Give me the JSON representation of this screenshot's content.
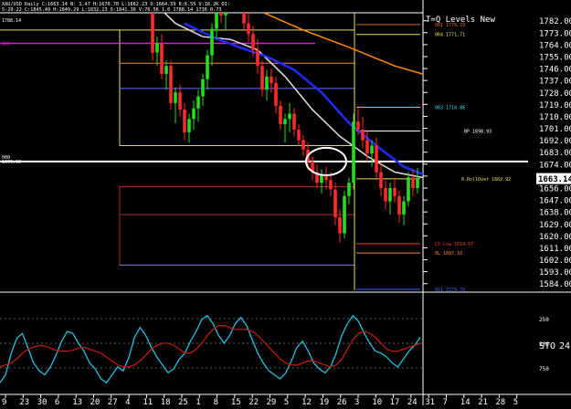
{
  "header": {
    "line1": "XAU/USD Daily C:1663.14  N:  1.47 H:1670.70 L:1662.23 O:1664.59 R:6.55 V:16.2K OI:",
    "line2": "5-20-22 C:1845.49 H:1849.29 L:1832.23 O:1841.36 V:76.5K 1.0 1788.14 1736 0.73",
    "left_value": "1788.14",
    "plot_title": "T=Q Levels New"
  },
  "chart_data": [
    {
      "type": "candlestick",
      "title": "XAU/USD Daily",
      "price_axis": {
        "ylim": [
          1579,
          1788
        ],
        "ticks": [
          1782,
          1773,
          1764,
          1755,
          1746,
          1737,
          1728,
          1719,
          1710,
          1701,
          1692,
          1683,
          1674,
          1665,
          1656,
          1647,
          1638,
          1629,
          1620,
          1611,
          1602,
          1593,
          1584
        ],
        "tick_labels": [
          "1782.00",
          "1773.00",
          "1764.00",
          "1755.00",
          "1746.00",
          "1737.00",
          "1728.00",
          "1719.00",
          "1710.00",
          "1701.00",
          "1692.00",
          "1683.00",
          "1674.00",
          "1665.00",
          "1656.00",
          "1647.00",
          "1638.00",
          "1629.00",
          "1620.00",
          "1611.00",
          "1602.00",
          "1593.00",
          "1584.00"
        ],
        "last_price": 1663.14,
        "last_price_label": "1663.14"
      },
      "x_axis": {
        "tick_labels": [
          "9",
          "23",
          "30",
          "6",
          "13",
          "20",
          "27",
          "4",
          "11",
          "18",
          "25",
          "1",
          "8",
          "15",
          "22",
          "29",
          "5",
          "12",
          "19",
          "26",
          "3",
          "10",
          "17",
          "24",
          "31",
          "7",
          "14",
          "21",
          "28",
          "5"
        ]
      },
      "levels": [
        {
          "label": "0R1 1779.19",
          "value": 1779.19,
          "color": "#e06a2a"
        },
        {
          "label": "0R4 1771.71",
          "value": 1771.71,
          "color": "#e8e060"
        },
        {
          "label": "0R3 1716.86",
          "value": 1716.86,
          "color": "#40e0ff"
        },
        {
          "label": "BP 1698.93",
          "value": 1698.93,
          "color": "#ffffff"
        },
        {
          "label": "1676.00",
          "value": 1676.0,
          "color": "#ffffff"
        },
        {
          "label": "0.RollOver 1662.92",
          "value": 1662.92,
          "color": "#e8e060"
        },
        {
          "label": "L5 Low 1614.07",
          "value": 1614.07,
          "color": "#ff3030"
        },
        {
          "label": "0L 1607.10",
          "value": 1607.1,
          "color": "#ff8040"
        },
        {
          "label": "0S1 1579.70",
          "value": 1579.7,
          "color": "#4060ff"
        }
      ],
      "left_labels": [
        "816",
        "000"
      ],
      "candles": [
        [
          1835,
          1850,
          1822,
          1840
        ],
        [
          1840,
          1848,
          1829,
          1832
        ],
        [
          1832,
          1836,
          1806,
          1810
        ],
        [
          1810,
          1826,
          1802,
          1822
        ],
        [
          1822,
          1828,
          1808,
          1812
        ],
        [
          1812,
          1820,
          1800,
          1806
        ],
        [
          1806,
          1812,
          1788,
          1790
        ],
        [
          1790,
          1794,
          1752,
          1758
        ],
        [
          1758,
          1770,
          1748,
          1765
        ],
        [
          1765,
          1772,
          1738,
          1742
        ],
        [
          1742,
          1752,
          1730,
          1748
        ],
        [
          1748,
          1752,
          1715,
          1720
        ],
        [
          1720,
          1732,
          1705,
          1728
        ],
        [
          1728,
          1734,
          1710,
          1715
        ],
        [
          1715,
          1720,
          1692,
          1698
        ],
        [
          1698,
          1712,
          1690,
          1708
        ],
        [
          1708,
          1722,
          1700,
          1716
        ],
        [
          1716,
          1730,
          1706,
          1725
        ],
        [
          1725,
          1742,
          1718,
          1738
        ],
        [
          1738,
          1760,
          1730,
          1756
        ],
        [
          1756,
          1780,
          1748,
          1776
        ],
        [
          1776,
          1800,
          1768,
          1795
        ],
        [
          1795,
          1812,
          1780,
          1786
        ],
        [
          1786,
          1808,
          1775,
          1800
        ],
        [
          1800,
          1822,
          1790,
          1815
        ],
        [
          1815,
          1830,
          1800,
          1808
        ],
        [
          1808,
          1820,
          1790,
          1795
        ],
        [
          1795,
          1802,
          1775,
          1780
        ],
        [
          1780,
          1792,
          1766,
          1772
        ],
        [
          1772,
          1778,
          1755,
          1760
        ],
        [
          1760,
          1768,
          1742,
          1748
        ],
        [
          1748,
          1752,
          1725,
          1730
        ],
        [
          1730,
          1745,
          1722,
          1740
        ],
        [
          1740,
          1746,
          1728,
          1735
        ],
        [
          1735,
          1740,
          1712,
          1718
        ],
        [
          1718,
          1722,
          1700,
          1704
        ],
        [
          1704,
          1712,
          1690,
          1708
        ],
        [
          1708,
          1720,
          1698,
          1712
        ],
        [
          1712,
          1716,
          1695,
          1700
        ],
        [
          1700,
          1704,
          1688,
          1692
        ],
        [
          1692,
          1696,
          1680,
          1685
        ],
        [
          1685,
          1690,
          1670,
          1676
        ],
        [
          1676,
          1680,
          1662,
          1668
        ],
        [
          1668,
          1674,
          1656,
          1660
        ],
        [
          1660,
          1670,
          1652,
          1666
        ],
        [
          1666,
          1672,
          1655,
          1662
        ],
        [
          1662,
          1668,
          1650,
          1655
        ],
        [
          1655,
          1660,
          1628,
          1634
        ],
        [
          1634,
          1640,
          1615,
          1622
        ],
        [
          1622,
          1654,
          1618,
          1650
        ],
        [
          1650,
          1664,
          1644,
          1660
        ],
        [
          1660,
          1712,
          1655,
          1706
        ],
        [
          1706,
          1718,
          1696,
          1700
        ],
        [
          1700,
          1710,
          1686,
          1692
        ],
        [
          1692,
          1700,
          1676,
          1682
        ],
        [
          1682,
          1692,
          1672,
          1688
        ],
        [
          1688,
          1694,
          1662,
          1668
        ],
        [
          1668,
          1674,
          1650,
          1656
        ],
        [
          1656,
          1662,
          1640,
          1646
        ],
        [
          1646,
          1660,
          1636,
          1656
        ],
        [
          1656,
          1664,
          1645,
          1650
        ],
        [
          1650,
          1654,
          1630,
          1636
        ],
        [
          1636,
          1650,
          1628,
          1646
        ],
        [
          1646,
          1668,
          1642,
          1664
        ],
        [
          1664,
          1670,
          1650,
          1656
        ],
        [
          1656,
          1671,
          1652,
          1663
        ]
      ],
      "moving_averages": [
        {
          "name": "",
          "color": "#ff8c00",
          "values": [
            [
              1,
              1806
            ],
            [
              10,
              1800
            ],
            [
              20,
              1798
            ],
            [
              30,
              1790
            ],
            [
              40,
              1775
            ],
            [
              50,
              1762
            ],
            [
              60,
              1748
            ],
            [
              70,
              1738
            ],
            [
              75,
              1730
            ]
          ]
        },
        {
          "name": "",
          "color": "#e0e0e0",
          "values": [
            [
              0,
              1820
            ],
            [
              6,
              1800
            ],
            [
              12,
              1780
            ],
            [
              18,
              1770
            ],
            [
              24,
              1768
            ],
            [
              30,
              1760
            ],
            [
              36,
              1740
            ],
            [
              42,
              1715
            ],
            [
              48,
              1695
            ],
            [
              54,
              1680
            ],
            [
              60,
              1668
            ],
            [
              66,
              1664
            ],
            [
              75,
              1663
            ]
          ]
        },
        {
          "name": "",
          "color": "#1e2cff",
          "values": [
            [
              14,
              1780
            ],
            [
              20,
              1770
            ],
            [
              26,
              1762
            ],
            [
              32,
              1755
            ],
            [
              38,
              1745
            ],
            [
              44,
              1728
            ],
            [
              50,
              1705
            ],
            [
              56,
              1688
            ],
            [
              62,
              1672
            ],
            [
              68,
              1664
            ],
            [
              75,
              1662
            ]
          ]
        },
        {
          "name": "",
          "color": "#e8e8e8",
          "values": [
            [
              52,
              1800
            ],
            [
              58,
              1795
            ],
            [
              64,
              1790
            ],
            [
              70,
              1784
            ],
            [
              75,
              1778
            ]
          ]
        }
      ]
    },
    {
      "type": "line",
      "title": "",
      "name_label": "STO",
      "value_label": "24.",
      "tick_labels": [
        "250",
        "500",
        "750"
      ],
      "ylim": [
        0,
        100
      ],
      "series": [
        {
          "name": "",
          "color": "#20c0e0",
          "values": [
            10,
            18,
            40,
            55,
            60,
            45,
            30,
            22,
            18,
            26,
            38,
            52,
            62,
            60,
            50,
            42,
            30,
            24,
            14,
            10,
            18,
            26,
            22,
            36,
            56,
            66,
            58,
            46,
            36,
            28,
            20,
            24,
            34,
            40,
            52,
            62,
            74,
            78,
            70,
            58,
            50,
            58,
            70,
            76,
            68,
            54,
            40,
            30,
            22,
            18,
            14,
            20,
            32,
            46,
            52,
            42,
            30,
            24,
            20,
            26,
            40,
            58,
            70,
            78,
            72,
            60,
            50,
            42,
            40,
            36,
            30,
            26,
            34,
            42,
            48,
            56
          ]
        },
        {
          "name": "",
          "color": "#c01818",
          "values": [
            26,
            28,
            30,
            34,
            40,
            44,
            46,
            48,
            47,
            45,
            43,
            42,
            42,
            43,
            45,
            46,
            44,
            42,
            40,
            36,
            32,
            28,
            26,
            26,
            28,
            32,
            38,
            44,
            48,
            50,
            50,
            48,
            44,
            40,
            40,
            44,
            50,
            58,
            64,
            68,
            68,
            66,
            64,
            64,
            64,
            62,
            58,
            52,
            46,
            40,
            34,
            30,
            28,
            28,
            30,
            32,
            32,
            30,
            28,
            26,
            28,
            34,
            44,
            54,
            60,
            62,
            60,
            56,
            50,
            44,
            42,
            42,
            44,
            46,
            48,
            50
          ]
        }
      ]
    }
  ]
}
